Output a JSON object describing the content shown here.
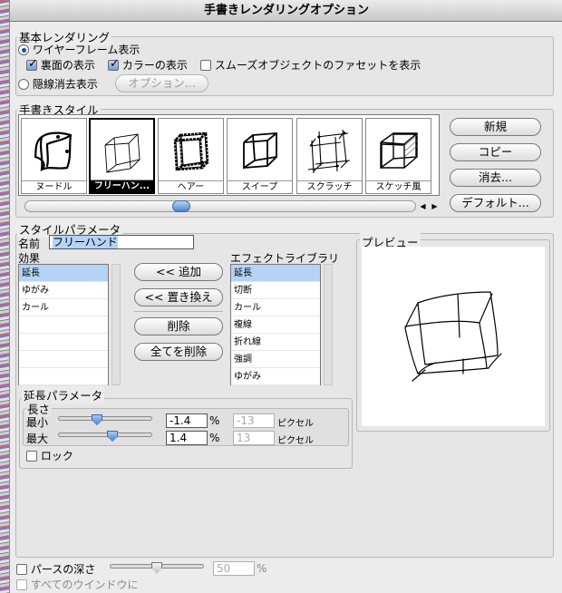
{
  "window": {
    "title": "手書きレンダリングオプション"
  },
  "basic": {
    "title": "基本レンダリング",
    "wireframe_label": "ワイヤーフレーム表示",
    "backface_label": "裏面の表示",
    "color_label": "カラーの表示",
    "smooth_label": "スムーズオブジェクトのファセットを表示",
    "hidden_label": "隠線消去表示",
    "options_button": "オプション..."
  },
  "styles": {
    "title": "手書きスタイル",
    "items": [
      {
        "label": "ヌードル",
        "icon": "noodle-cube-icon"
      },
      {
        "label": "フリーハン...",
        "icon": "freehand-cube-icon"
      },
      {
        "label": "ヘアー",
        "icon": "hair-cube-icon"
      },
      {
        "label": "スイープ",
        "icon": "sweep-cube-icon"
      },
      {
        "label": "スクラッチ",
        "icon": "scratch-cube-icon"
      },
      {
        "label": "スケッチ風",
        "icon": "sketch-cube-icon"
      }
    ],
    "buttons": {
      "new": "新規",
      "copy": "コピー",
      "delete": "消去...",
      "default": "デフォルト..."
    }
  },
  "params": {
    "title": "スタイルパラメータ",
    "name_label": "名前",
    "name_value": "フリーハンド",
    "effects_label": "効果",
    "effects": [
      "延長",
      "ゆがみ",
      "カール",
      "",
      "",
      "",
      ""
    ],
    "add_button": "<< 追加",
    "replace_button": "<< 置き換え",
    "delete_button": "削除",
    "delete_all_button": "全てを削除",
    "library_label": "エフェクトライブラリ",
    "library": [
      "延長",
      "切断",
      "カール",
      "複線",
      "折れ線",
      "強調",
      "ゆがみ"
    ],
    "preview_label": "プレビュー"
  },
  "extend": {
    "title": "延長パラメータ",
    "length_label": "長さ",
    "min_label": "最小",
    "min_value": "-1.4",
    "min_unit": "%",
    "min_px": "-13",
    "max_label": "最大",
    "max_value": "1.4",
    "max_unit": "%",
    "max_px": "13",
    "px_unit": "ピクセル",
    "lock_label": "ロック"
  },
  "footer": {
    "depth_label": "パースの深さ",
    "depth_value": "50",
    "depth_unit": "%",
    "all_windows_label": "すべてのウインドウに"
  },
  "colors": {
    "accent": "#4f84cf",
    "selection": "#b5d3f7"
  }
}
